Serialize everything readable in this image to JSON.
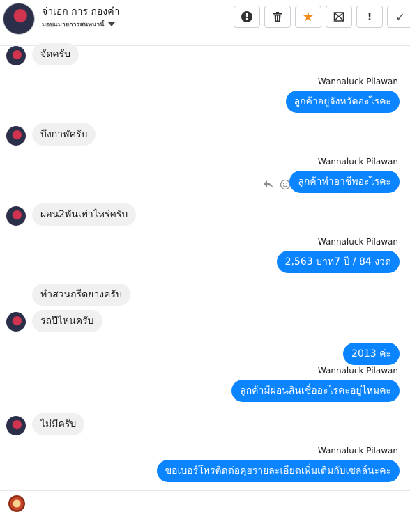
{
  "header": {
    "contact_name": "จ่าเอก การ กองคำ",
    "contact_subtitle": "มอบแมายการสนทนานี้",
    "toolbar": [
      {
        "name": "report-button",
        "icon": "exclamation-circle-icon"
      },
      {
        "name": "delete-button",
        "icon": "trash-icon"
      },
      {
        "name": "star-button",
        "icon": "star-icon",
        "color": "#f08a18"
      },
      {
        "name": "mark-unread-button",
        "icon": "envelope-icon"
      },
      {
        "name": "important-button",
        "icon": "exclamation-icon"
      },
      {
        "name": "done-button",
        "icon": "check-icon"
      }
    ]
  },
  "messages": [
    {
      "direction": "in",
      "text": "จัดครับ"
    },
    {
      "direction": "out",
      "sender": "Wannaluck Pilawan",
      "text": "ลูกค้าอยู่จังหวัดอะไรคะ"
    },
    {
      "direction": "in",
      "text": "บึงกาฬครับ"
    },
    {
      "direction": "out",
      "sender": "Wannaluck Pilawan",
      "text": "ลูกค้าทำอาชีพอะไรคะ"
    },
    {
      "direction": "in",
      "text": "ผ่อน2พันเท่าไหร่ครับ"
    },
    {
      "direction": "out",
      "sender": "Wannaluck Pilawan",
      "text": "2,563 บาท7 ปี / 84 งวด"
    },
    {
      "direction": "in",
      "text": "ทำสวนกรีดยางครับ"
    },
    {
      "direction": "in",
      "text": "รถปีไหนครับ"
    },
    {
      "direction": "out",
      "text": "2013  ค่ะ"
    },
    {
      "direction": "out",
      "sender": "Wannaluck Pilawan",
      "text": "ลูกค้ามีผ่อนสินเชื่ออะไรคะอยู่ไหมคะ"
    },
    {
      "direction": "in",
      "text": "ไม่มีครับ"
    },
    {
      "direction": "out",
      "sender": "Wannaluck Pilawan",
      "text": "ขอเบอร์โทรติดต่อคุยรายละเอียดเพิ่มเติมกับเซลล์นะคะ"
    }
  ],
  "colors": {
    "outgoing_bubble": "#0a84ff",
    "incoming_bubble": "#f0f0f0"
  }
}
